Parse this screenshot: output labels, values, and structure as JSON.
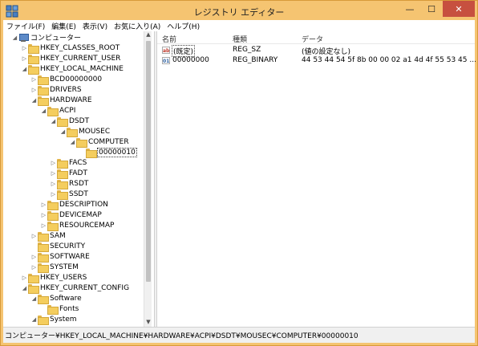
{
  "window": {
    "title": "レジストリ エディター",
    "close_glyph": "✕",
    "minimize_glyph": "—",
    "maximize_glyph": "☐"
  },
  "menu": [
    "ファイル(F)",
    "編集(E)",
    "表示(V)",
    "お気に入り(A)",
    "ヘルプ(H)"
  ],
  "tree": [
    {
      "label": "コンピューター",
      "arrow": "◢",
      "icon": "computer-icon"
    },
    {
      "label": "HKEY_CLASSES_ROOT",
      "arrow": "▷",
      "icon": "folder-icon"
    },
    {
      "label": "HKEY_CURRENT_USER",
      "arrow": "▷",
      "icon": "folder-icon"
    },
    {
      "label": "HKEY_LOCAL_MACHINE",
      "arrow": "◢",
      "icon": "folder-icon"
    },
    {
      "label": "BCD00000000",
      "arrow": "▷",
      "icon": "folder-icon"
    },
    {
      "label": "DRIVERS",
      "arrow": "▷",
      "icon": "folder-icon"
    },
    {
      "label": "HARDWARE",
      "arrow": "◢",
      "icon": "folder-icon"
    },
    {
      "label": "ACPI",
      "arrow": "◢",
      "icon": "folder-icon"
    },
    {
      "label": "DSDT",
      "arrow": "◢",
      "icon": "folder-icon"
    },
    {
      "label": "MOUSEC",
      "arrow": "◢",
      "icon": "folder-icon"
    },
    {
      "label": "COMPUTER",
      "arrow": "◢",
      "icon": "folder-icon"
    },
    {
      "label": "00000010",
      "arrow": "",
      "icon": "folder-icon"
    },
    {
      "label": "FACS",
      "arrow": "▷",
      "icon": "folder-icon"
    },
    {
      "label": "FADT",
      "arrow": "▷",
      "icon": "folder-icon"
    },
    {
      "label": "RSDT",
      "arrow": "▷",
      "icon": "folder-icon"
    },
    {
      "label": "SSDT",
      "arrow": "▷",
      "icon": "folder-icon"
    },
    {
      "label": "DESCRIPTION",
      "arrow": "▷",
      "icon": "folder-icon"
    },
    {
      "label": "DEVICEMAP",
      "arrow": "▷",
      "icon": "folder-icon"
    },
    {
      "label": "RESOURCEMAP",
      "arrow": "▷",
      "icon": "folder-icon"
    },
    {
      "label": "SAM",
      "arrow": "▷",
      "icon": "folder-icon"
    },
    {
      "label": "SECURITY",
      "arrow": "",
      "icon": "folder-icon"
    },
    {
      "label": "SOFTWARE",
      "arrow": "▷",
      "icon": "folder-icon"
    },
    {
      "label": "SYSTEM",
      "arrow": "▷",
      "icon": "folder-icon"
    },
    {
      "label": "HKEY_USERS",
      "arrow": "▷",
      "icon": "folder-icon"
    },
    {
      "label": "HKEY_CURRENT_CONFIG",
      "arrow": "◢",
      "icon": "folder-icon"
    },
    {
      "label": "Software",
      "arrow": "◢",
      "icon": "folder-icon"
    },
    {
      "label": "Fonts",
      "arrow": "",
      "icon": "folder-icon"
    },
    {
      "label": "System",
      "arrow": "◢",
      "icon": "folder-icon"
    }
  ],
  "list": {
    "columns": [
      "名前",
      "種類",
      "データ"
    ],
    "rows": [
      {
        "icon": "ab",
        "name": "(既定)",
        "type": "REG_SZ",
        "data": "(値の設定なし)"
      },
      {
        "icon": "bin",
        "name": "00000000",
        "type": "REG_BINARY",
        "data": "44 53 44 54 5f 8b 00 00 02 a1 4d 4f 55 53 45 ..."
      }
    ]
  },
  "status": "コンピューター¥HKEY_LOCAL_MACHINE¥HARDWARE¥ACPI¥DSDT¥MOUSEC¥COMPUTER¥00000010",
  "scroll": {
    "up_glyph": "▲",
    "down_glyph": "▼"
  }
}
